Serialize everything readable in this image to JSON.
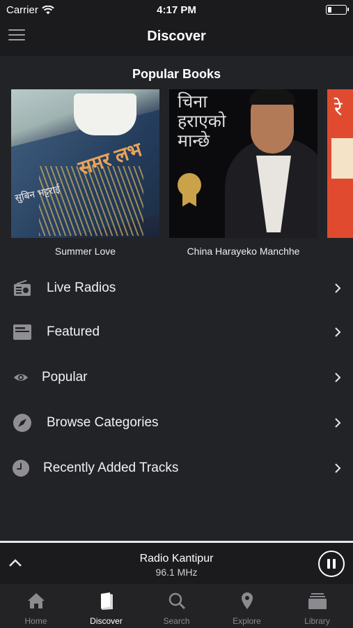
{
  "status": {
    "carrier": "Carrier",
    "time": "4:17 PM",
    "battery_level": 0.2
  },
  "nav": {
    "title": "Discover"
  },
  "popular": {
    "title": "Popular Books",
    "books": [
      {
        "title": "Summer Love"
      },
      {
        "title": "China Harayeko Manchhe"
      },
      {
        "title": ""
      }
    ]
  },
  "menu": [
    {
      "label": "Live Radios",
      "icon": "radio-icon"
    },
    {
      "label": "Featured",
      "icon": "featured-icon"
    },
    {
      "label": "Popular",
      "icon": "eye-icon"
    },
    {
      "label": "Browse Categories",
      "icon": "compass-icon"
    },
    {
      "label": "Recently Added Tracks",
      "icon": "clock-icon"
    }
  ],
  "player": {
    "station": "Radio Kantipur",
    "frequency": "96.1 MHz"
  },
  "tabs": [
    {
      "label": "Home",
      "icon": "home-icon",
      "active": false
    },
    {
      "label": "Discover",
      "icon": "book-icon",
      "active": true
    },
    {
      "label": "Search",
      "icon": "search-icon",
      "active": false
    },
    {
      "label": "Explore",
      "icon": "location-pin-icon",
      "active": false
    },
    {
      "label": "Library",
      "icon": "library-icon",
      "active": false
    }
  ],
  "colors": {
    "background": "#222327",
    "bar": "#1b1b1d",
    "active_tab": "#ffffff",
    "inactive_tab": "#8b8b8f"
  }
}
